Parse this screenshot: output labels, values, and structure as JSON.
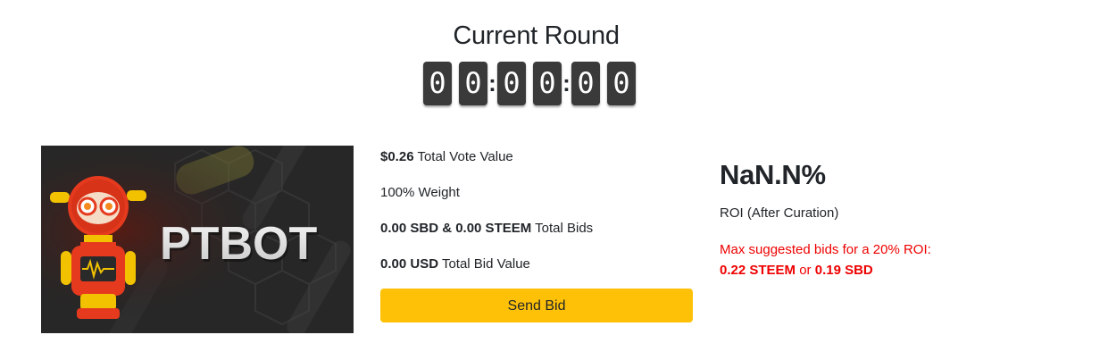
{
  "header": {
    "title": "Current Round",
    "timer": {
      "digits": [
        "0",
        "0",
        "0",
        "0",
        "0",
        "0"
      ],
      "separator": ":"
    }
  },
  "bot": {
    "banner_text": "PTBOT",
    "banner_icon": "robot-mascot"
  },
  "info": {
    "vote_value_amount": "$0.26",
    "vote_value_label": "Total Vote Value",
    "weight": "100% Weight",
    "total_bids_amount": "0.00 SBD & 0.00 STEEM",
    "total_bids_label": "Total Bids",
    "bid_value_amount": "0.00 USD",
    "bid_value_label": "Total Bid Value",
    "send_bid_label": "Send Bid"
  },
  "roi": {
    "value": "NaN.N%",
    "label": "ROI (After Curation)",
    "suggest_text": "Max suggested bids for a 20% ROI:",
    "suggest_steem": "0.22 STEEM",
    "suggest_or": "or",
    "suggest_sbd": "0.19 SBD"
  },
  "colors": {
    "button": "#ffc107",
    "timer_bg": "#3a3a3a",
    "warning_text": "#ee0000"
  }
}
